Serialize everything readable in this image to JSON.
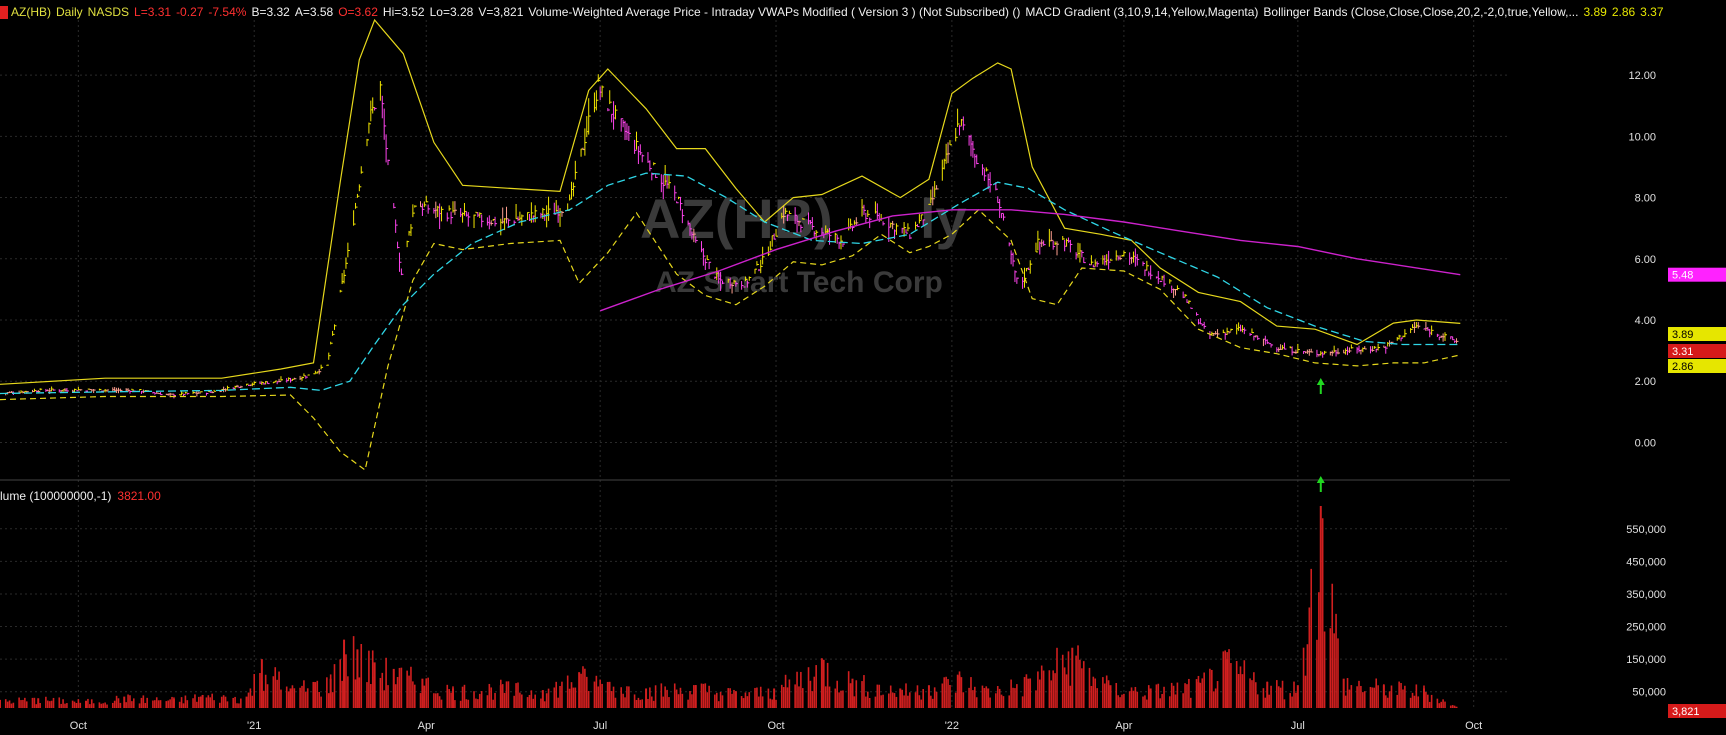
{
  "header": {
    "symbol": "AZ(HB)",
    "interval": "Daily",
    "exchange": "NASDS",
    "last": "L=3.31",
    "change": "-0.27",
    "change_pct": "-7.54%",
    "bid": "B=3.32",
    "ask": "A=3.58",
    "open": "O=3.62",
    "high": "Hi=3.52",
    "low": "Lo=3.28",
    "volume": "V=3,821",
    "studies": [
      "Volume-Weighted Average Price - Intraday VWAPs Modified ( Version 3 ) (Not Subscribed) ()",
      "MACD Gradient (3,10,9,14,Yellow,Magenta)",
      "Bollinger Bands (Close,Close,Close,20,2,-2,0,true,Yellow,..."
    ],
    "bb_values": [
      "3.89",
      "2.86",
      "3.37"
    ]
  },
  "volume_panel": {
    "label": "lume (100000000,-1)",
    "value": "3821.00"
  },
  "watermark": {
    "symbol": "AZ(HB)",
    "name": "AZ Smart Tech Corp",
    "suffix": "ly"
  },
  "colors": {
    "background": "#000000",
    "up_bar": "#f2e600",
    "down_bar": "#ff44ee",
    "mid_bar": "#ffa090",
    "bollinger": "#e6d81c",
    "vwap": "#2fd6e6",
    "ma_long": "#cc22cc",
    "volume": "#d11f1f",
    "arrow": "#21d821",
    "grid": "#2a2a2a"
  },
  "chart_data": {
    "type": "line",
    "price_axis": {
      "ticks": [
        "12.00",
        "10.00",
        "8.00",
        "6.00",
        "4.00",
        "2.00",
        "0.00"
      ],
      "ylim": [
        -0.9,
        13.8
      ]
    },
    "volume_axis": {
      "ticks": [
        "550,000",
        "450,000",
        "350,000",
        "250,000",
        "150,000",
        "50,000"
      ],
      "ylim": [
        0,
        620000
      ]
    },
    "x_ticks": [
      "Oct",
      "'21",
      "Apr",
      "Jul",
      "Oct",
      "'22",
      "Apr",
      "Jul",
      "Oct"
    ],
    "price_labels": [
      {
        "value": 5.48,
        "text": "5.48",
        "color": "#ff22ff"
      },
      {
        "value": 3.89,
        "text": "3.89",
        "color": "#e6e600"
      },
      {
        "value": 3.31,
        "text": "3.31",
        "color": "#d61a1a"
      },
      {
        "value": 2.86,
        "text": "2.86",
        "color": "#e6e600"
      }
    ],
    "volume_label": {
      "text": "3,821",
      "color": "#d61a1a"
    },
    "close": [
      [
        "2020-08-21",
        1.6
      ],
      [
        "2020-09-10",
        1.7
      ],
      [
        "2020-10-01",
        1.72
      ],
      [
        "2020-11-01",
        1.7
      ],
      [
        "2020-11-18",
        1.55
      ],
      [
        "2020-12-10",
        1.65
      ],
      [
        "2020-12-28",
        1.9
      ],
      [
        "2021-01-15",
        2.0
      ],
      [
        "2021-01-30",
        2.2
      ],
      [
        "2021-02-08",
        2.5
      ],
      [
        "2021-02-20",
        6.5
      ],
      [
        "2021-03-02",
        10.5
      ],
      [
        "2021-03-08",
        11.6
      ],
      [
        "2021-03-12",
        9.0
      ],
      [
        "2021-03-19",
        5.5
      ],
      [
        "2021-03-26",
        7.8
      ],
      [
        "2021-04-05",
        7.6
      ],
      [
        "2021-04-20",
        7.4
      ],
      [
        "2021-05-10",
        7.2
      ],
      [
        "2021-05-25",
        7.4
      ],
      [
        "2021-06-05",
        7.5
      ],
      [
        "2021-06-15",
        7.8
      ],
      [
        "2021-06-25",
        10.5
      ],
      [
        "2021-06-30",
        11.6
      ],
      [
        "2021-07-10",
        10.5
      ],
      [
        "2021-07-25",
        9.2
      ],
      [
        "2021-08-10",
        8.0
      ],
      [
        "2021-08-20",
        6.5
      ],
      [
        "2021-09-01",
        5.3
      ],
      [
        "2021-09-15",
        5.2
      ],
      [
        "2021-09-25",
        6.0
      ],
      [
        "2021-10-05",
        7.5
      ],
      [
        "2021-10-20",
        7.0
      ],
      [
        "2021-11-05",
        6.6
      ],
      [
        "2021-11-15",
        7.5
      ],
      [
        "2021-11-25",
        7.3
      ],
      [
        "2021-12-10",
        6.8
      ],
      [
        "2021-12-20",
        7.6
      ],
      [
        "2022-01-05",
        10.5
      ],
      [
        "2022-01-15",
        9.2
      ],
      [
        "2022-01-25",
        8.0
      ],
      [
        "2022-02-05",
        5.0
      ],
      [
        "2022-02-15",
        6.5
      ],
      [
        "2022-02-28",
        6.6
      ],
      [
        "2022-03-15",
        5.8
      ],
      [
        "2022-04-01",
        6.2
      ],
      [
        "2022-04-15",
        5.6
      ],
      [
        "2022-05-01",
        4.9
      ],
      [
        "2022-05-15",
        3.5
      ],
      [
        "2022-06-01",
        3.7
      ],
      [
        "2022-06-20",
        3.1
      ],
      [
        "2022-07-10",
        2.9
      ],
      [
        "2022-07-25",
        3.0
      ],
      [
        "2022-08-15",
        3.1
      ],
      [
        "2022-09-01",
        3.8
      ],
      [
        "2022-09-10",
        3.6
      ],
      [
        "2022-09-22",
        3.3
      ]
    ],
    "bb_upper": [
      [
        "2020-08-21",
        1.9
      ],
      [
        "2020-10-15",
        2.1
      ],
      [
        "2020-12-15",
        2.1
      ],
      [
        "2021-01-15",
        2.4
      ],
      [
        "2021-02-01",
        2.6
      ],
      [
        "2021-02-15",
        8.5
      ],
      [
        "2021-02-25",
        12.5
      ],
      [
        "2021-03-05",
        13.8
      ],
      [
        "2021-03-20",
        12.7
      ],
      [
        "2021-04-05",
        9.8
      ],
      [
        "2021-04-20",
        8.4
      ],
      [
        "2021-05-15",
        8.3
      ],
      [
        "2021-06-10",
        8.2
      ],
      [
        "2021-06-25",
        11.5
      ],
      [
        "2021-07-05",
        12.2
      ],
      [
        "2021-07-25",
        10.9
      ],
      [
        "2021-08-10",
        9.6
      ],
      [
        "2021-08-25",
        9.6
      ],
      [
        "2021-09-10",
        8.3
      ],
      [
        "2021-09-25",
        7.2
      ],
      [
        "2021-10-10",
        8.0
      ],
      [
        "2021-10-25",
        8.1
      ],
      [
        "2021-11-15",
        8.7
      ],
      [
        "2021-12-05",
        8.0
      ],
      [
        "2021-12-20",
        8.6
      ],
      [
        "2022-01-01",
        11.4
      ],
      [
        "2022-01-12",
        11.9
      ],
      [
        "2022-01-25",
        12.4
      ],
      [
        "2022-02-01",
        12.2
      ],
      [
        "2022-02-12",
        9.0
      ],
      [
        "2022-03-01",
        7.0
      ],
      [
        "2022-03-20",
        6.8
      ],
      [
        "2022-04-05",
        6.6
      ],
      [
        "2022-04-20",
        5.7
      ],
      [
        "2022-05-10",
        4.9
      ],
      [
        "2022-06-01",
        4.6
      ],
      [
        "2022-06-20",
        3.8
      ],
      [
        "2022-07-10",
        3.7
      ],
      [
        "2022-08-01",
        3.2
      ],
      [
        "2022-08-20",
        3.9
      ],
      [
        "2022-09-01",
        4.0
      ],
      [
        "2022-09-24",
        3.89
      ]
    ],
    "bb_lower": [
      [
        "2020-08-21",
        1.4
      ],
      [
        "2020-10-15",
        1.5
      ],
      [
        "2020-12-15",
        1.5
      ],
      [
        "2021-01-20",
        1.55
      ],
      [
        "2021-02-01",
        0.8
      ],
      [
        "2021-02-15",
        -0.3
      ],
      [
        "2021-02-28",
        -0.9
      ],
      [
        "2021-03-12",
        2.5
      ],
      [
        "2021-03-25",
        5.3
      ],
      [
        "2021-04-05",
        6.5
      ],
      [
        "2021-04-20",
        6.3
      ],
      [
        "2021-05-15",
        6.5
      ],
      [
        "2021-06-10",
        6.6
      ],
      [
        "2021-06-20",
        5.2
      ],
      [
        "2021-07-05",
        6.2
      ],
      [
        "2021-07-20",
        7.5
      ],
      [
        "2021-08-10",
        5.5
      ],
      [
        "2021-08-25",
        4.8
      ],
      [
        "2021-09-10",
        4.5
      ],
      [
        "2021-09-25",
        5.1
      ],
      [
        "2021-10-10",
        5.9
      ],
      [
        "2021-10-25",
        5.8
      ],
      [
        "2021-11-10",
        6.1
      ],
      [
        "2021-11-25",
        6.8
      ],
      [
        "2021-12-10",
        6.2
      ],
      [
        "2021-12-20",
        6.4
      ],
      [
        "2022-01-01",
        6.8
      ],
      [
        "2022-01-15",
        7.6
      ],
      [
        "2022-02-01",
        6.6
      ],
      [
        "2022-02-12",
        4.7
      ],
      [
        "2022-02-25",
        4.5
      ],
      [
        "2022-03-10",
        5.7
      ],
      [
        "2022-04-01",
        5.6
      ],
      [
        "2022-04-20",
        5.0
      ],
      [
        "2022-05-10",
        3.7
      ],
      [
        "2022-06-01",
        3.1
      ],
      [
        "2022-06-20",
        2.9
      ],
      [
        "2022-07-10",
        2.6
      ],
      [
        "2022-08-01",
        2.5
      ],
      [
        "2022-08-20",
        2.6
      ],
      [
        "2022-09-05",
        2.6
      ],
      [
        "2022-09-24",
        2.86
      ]
    ],
    "vwap": [
      [
        "2020-08-21",
        1.6
      ],
      [
        "2020-10-15",
        1.65
      ],
      [
        "2020-12-15",
        1.7
      ],
      [
        "2021-01-20",
        1.8
      ],
      [
        "2021-02-05",
        1.7
      ],
      [
        "2021-02-20",
        2.0
      ],
      [
        "2021-03-05",
        3.2
      ],
      [
        "2021-03-20",
        4.5
      ],
      [
        "2021-04-05",
        5.5
      ],
      [
        "2021-04-25",
        6.5
      ],
      [
        "2021-05-20",
        7.2
      ],
      [
        "2021-06-15",
        7.6
      ],
      [
        "2021-07-05",
        8.4
      ],
      [
        "2021-07-25",
        8.8
      ],
      [
        "2021-08-15",
        8.7
      ],
      [
        "2021-09-05",
        8.0
      ],
      [
        "2021-09-25",
        7.2
      ],
      [
        "2021-10-20",
        6.6
      ],
      [
        "2021-11-15",
        6.5
      ],
      [
        "2021-12-10",
        6.8
      ],
      [
        "2022-01-05",
        7.8
      ],
      [
        "2022-01-25",
        8.5
      ],
      [
        "2022-02-10",
        8.3
      ],
      [
        "2022-03-01",
        7.6
      ],
      [
        "2022-03-25",
        6.9
      ],
      [
        "2022-04-20",
        6.2
      ],
      [
        "2022-05-20",
        5.4
      ],
      [
        "2022-06-15",
        4.4
      ],
      [
        "2022-07-10",
        3.8
      ],
      [
        "2022-08-05",
        3.3
      ],
      [
        "2022-08-25",
        3.2
      ],
      [
        "2022-09-24",
        3.2
      ]
    ],
    "ma_long": [
      [
        "2021-07-01",
        4.3
      ],
      [
        "2021-08-01",
        5.0
      ],
      [
        "2021-09-01",
        5.6
      ],
      [
        "2021-10-01",
        6.3
      ],
      [
        "2021-11-01",
        6.9
      ],
      [
        "2021-12-01",
        7.4
      ],
      [
        "2022-01-01",
        7.6
      ],
      [
        "2022-02-01",
        7.6
      ],
      [
        "2022-03-01",
        7.45
      ],
      [
        "2022-04-01",
        7.2
      ],
      [
        "2022-05-01",
        6.9
      ],
      [
        "2022-06-01",
        6.6
      ],
      [
        "2022-07-01",
        6.4
      ],
      [
        "2022-08-01",
        6.0
      ],
      [
        "2022-09-24",
        5.48
      ]
    ],
    "volume": [
      [
        "2020-08-21",
        25000
      ],
      [
        "2020-09-10",
        30000
      ],
      [
        "2020-10-05",
        22000
      ],
      [
        "2020-10-25",
        35000
      ],
      [
        "2020-11-20",
        28000
      ],
      [
        "2020-12-05",
        40000
      ],
      [
        "2020-12-28",
        35000
      ],
      [
        "2021-01-05",
        150000
      ],
      [
        "2021-01-20",
        60000
      ],
      [
        "2021-02-01",
        80000
      ],
      [
        "2021-02-10",
        90000
      ],
      [
        "2021-02-17",
        210000
      ],
      [
        "2021-02-24",
        180000
      ],
      [
        "2021-03-05",
        140000
      ],
      [
        "2021-03-15",
        120000
      ],
      [
        "2021-03-30",
        90000
      ],
      [
        "2021-04-15",
        60000
      ],
      [
        "2021-05-10",
        70000
      ],
      [
        "2021-06-01",
        55000
      ],
      [
        "2021-06-20",
        110000
      ],
      [
        "2021-07-05",
        80000
      ],
      [
        "2021-07-25",
        60000
      ],
      [
        "2021-08-20",
        70000
      ],
      [
        "2021-09-10",
        50000
      ],
      [
        "2021-09-30",
        60000
      ],
      [
        "2021-10-25",
        150000
      ],
      [
        "2021-11-10",
        90000
      ],
      [
        "2021-12-05",
        60000
      ],
      [
        "2021-12-20",
        70000
      ],
      [
        "2022-01-05",
        100000
      ],
      [
        "2022-01-20",
        60000
      ],
      [
        "2022-02-10",
        90000
      ],
      [
        "2022-03-05",
        185000
      ],
      [
        "2022-03-25",
        70000
      ],
      [
        "2022-04-15",
        60000
      ],
      [
        "2022-05-10",
        80000
      ],
      [
        "2022-05-25",
        150000
      ],
      [
        "2022-06-15",
        80000
      ],
      [
        "2022-07-01",
        70000
      ],
      [
        "2022-07-13",
        620000
      ],
      [
        "2022-07-25",
        90000
      ],
      [
        "2022-08-15",
        70000
      ],
      [
        "2022-09-05",
        60000
      ],
      [
        "2022-09-22",
        3821
      ]
    ],
    "arrows": [
      {
        "date": "2022-07-13",
        "price": 2.3
      },
      {
        "date": "2022-07-13",
        "price": -0.9
      }
    ]
  }
}
